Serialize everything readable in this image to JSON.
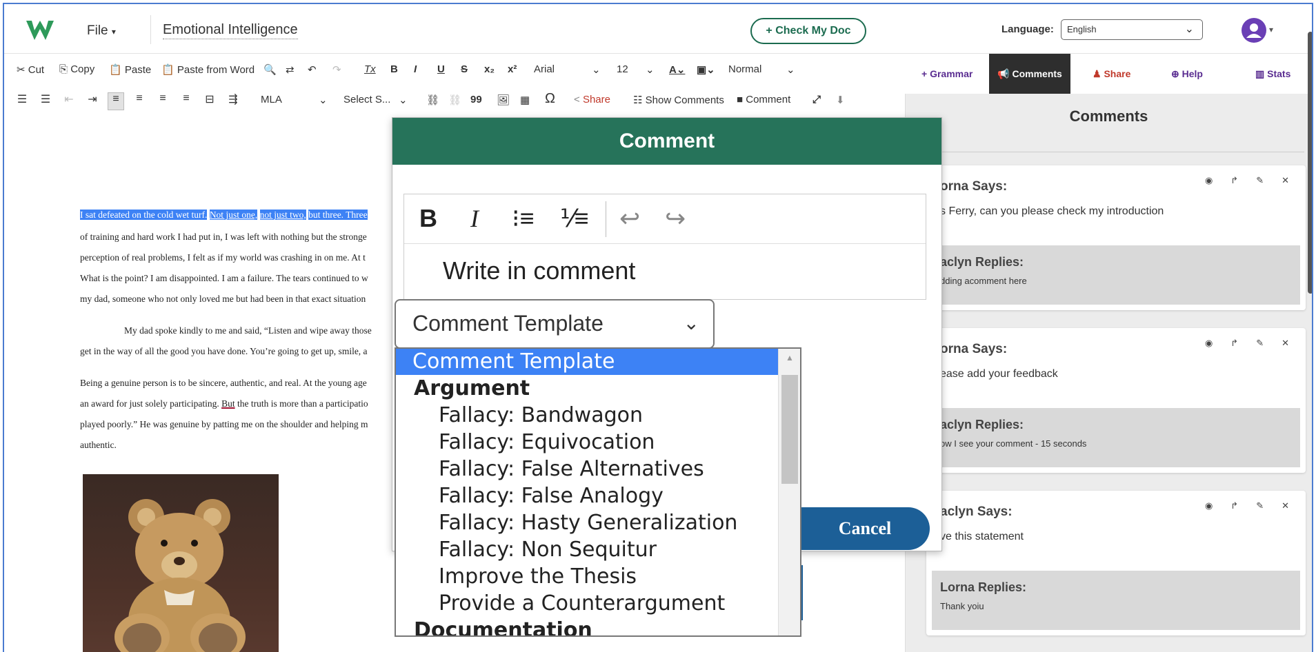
{
  "header": {
    "file_menu": "File",
    "doc_title": "Emotional Intelligence",
    "check_doc": "+ Check My Doc",
    "language_label": "Language:",
    "language_value": "English"
  },
  "toolbar1": {
    "cut": "Cut",
    "copy": "Copy",
    "paste": "Paste",
    "paste_word": "Paste from Word",
    "font": "Arial",
    "size": "12",
    "style": "Normal"
  },
  "toolbar2": {
    "citation": "MLA",
    "select_source": "Select S...",
    "share": "Share",
    "show_comments": "Show Comments",
    "comment": "Comment"
  },
  "right_tabs": {
    "grammar": "Grammar",
    "comments": "Comments",
    "share": "Share",
    "help": "Help",
    "stats": "Stats"
  },
  "document": {
    "lines": [
      {
        "hl1": "I sat defeated on the cold wet turf.",
        "hl2": "Not just one,",
        "hl3": "not just two,",
        "hl4": "but three. Three"
      },
      {
        "text": "of training and hard work I had put in, I was left with nothing but the stronge"
      },
      {
        "text": "perception of real problems, I felt as if my world was crashing in on me. At t"
      },
      {
        "text": "What is the point? I am disappointed. I am a failure. The tears continued to w"
      },
      {
        "text": "my dad, someone who not only loved me but had been in that exact situation"
      }
    ],
    "para2_line1": "My dad spoke kindly to me and said, “Listen and wipe away those",
    "para2_line2": "get in the way of all the good you have done. You’re going to get up, smile, a",
    "para3_line1": "Being a genuine person is to be sincere, authentic, and real. At the young age",
    "para3_line2_a": "an award for just solely participating.",
    "para3_line2_b": "But",
    "para3_line2_c": "the truth is more than a participatio",
    "para3_line3": "played poorly.” He was genuine by patting me on the shoulder and helping m",
    "para3_line4": "authentic."
  },
  "comments_panel": {
    "title": "Comments",
    "comments": [
      {
        "author": "orna Says:",
        "body": "s Ferry, can you please check my introduction",
        "reply_author": "aclyn Replies:",
        "reply_body": "dding acomment here"
      },
      {
        "author": "orna Says:",
        "body": "ease add your feedback",
        "reply_author": "aclyn Replies:",
        "reply_body": "ow I see your comment - 15 seconds"
      },
      {
        "author": "aclyn Says:",
        "body": "ve this statement",
        "reply_author": "Lorna Replies:",
        "reply_body": "Thank yoiu"
      }
    ]
  },
  "modal": {
    "title": "Comment",
    "placeholder": "Write in comment",
    "template_select": "Comment Template",
    "cancel": "Cancel"
  },
  "template_dropdown": {
    "items": [
      {
        "label": "Comment Template",
        "kind": "selected"
      },
      {
        "label": "Argument",
        "kind": "group"
      },
      {
        "label": "Fallacy: Bandwagon",
        "kind": "opt"
      },
      {
        "label": "Fallacy: Equivocation",
        "kind": "opt"
      },
      {
        "label": "Fallacy: False Alternatives",
        "kind": "opt"
      },
      {
        "label": "Fallacy: False Analogy",
        "kind": "opt"
      },
      {
        "label": "Fallacy: Hasty Generalization",
        "kind": "opt"
      },
      {
        "label": "Fallacy: Non Sequitur",
        "kind": "opt"
      },
      {
        "label": "Improve the Thesis",
        "kind": "opt"
      },
      {
        "label": "Provide a Counterargument",
        "kind": "opt"
      },
      {
        "label": "Documentation",
        "kind": "group"
      }
    ]
  },
  "colors": {
    "brand_green": "#26735a",
    "selection_blue": "#3d82f5",
    "cancel_blue": "#1c5f97",
    "share_red": "#c0392b",
    "grammar_purple": "#5a2d91"
  }
}
